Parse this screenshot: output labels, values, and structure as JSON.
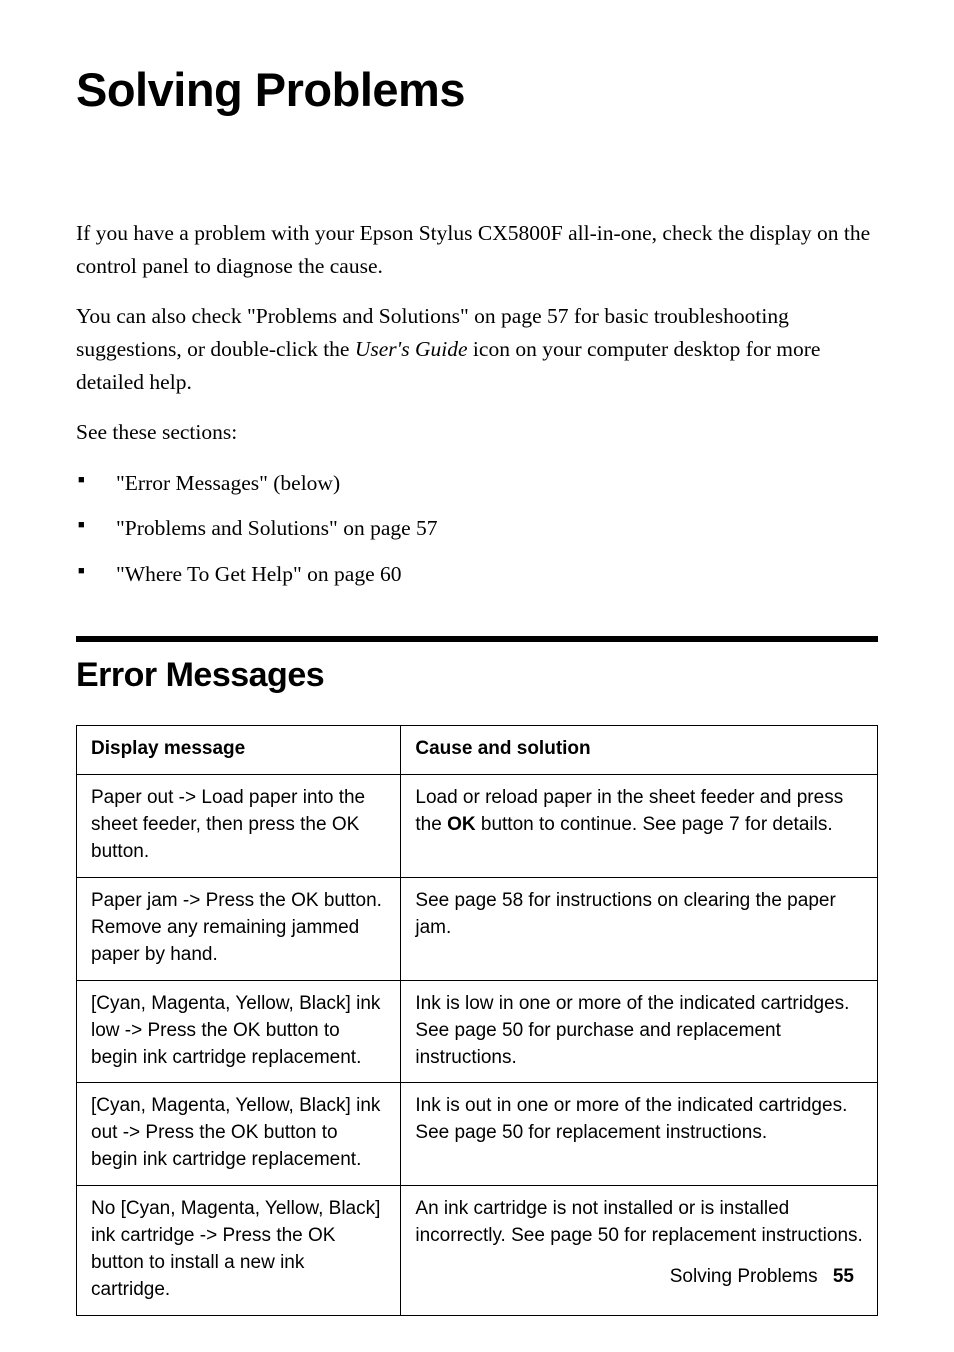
{
  "title": "Solving Problems",
  "intro": {
    "p1": "If you have a problem with your Epson Stylus CX5800F all-in-one, check the display on the control panel to diagnose the cause.",
    "p2a": "You can also check \"Problems and Solutions\" on page 57 for basic troubleshooting suggestions, or double-click the ",
    "p2b": "User's Guide",
    "p2c": " icon on your computer desktop for more detailed help.",
    "see": "See these sections:"
  },
  "bullets": [
    "\"Error Messages\" (below)",
    "\"Problems and Solutions\" on page 57",
    "\"Where To Get Help\" on page 60"
  ],
  "section_heading": "Error Messages",
  "table": {
    "headers": [
      "Display message",
      "Cause and solution"
    ],
    "rows": [
      {
        "msg": "Paper out -> Load paper into the sheet feeder, then press the OK button.",
        "sol_a": "Load or reload paper in the sheet feeder and press the ",
        "sol_b": "OK",
        "sol_c": " button to continue. See page 7 for details."
      },
      {
        "msg": "Paper jam -> Press the OK button. Remove any remaining jammed paper by hand.",
        "sol": "See page 58 for instructions on clearing the paper jam."
      },
      {
        "msg": "[Cyan, Magenta, Yellow, Black] ink low -> Press the OK button to begin ink cartridge replacement.",
        "sol": "Ink is low in one or more of the indicated cartridges. See page 50 for purchase and replacement instructions."
      },
      {
        "msg": "[Cyan, Magenta, Yellow, Black] ink out -> Press the OK button to begin ink cartridge replacement.",
        "sol": "Ink is out in one or more of the indicated cartridges. See page 50 for replacement instructions."
      },
      {
        "msg": "No [Cyan, Magenta, Yellow, Black] ink cartridge -> Press the OK button to install a new ink cartridge.",
        "sol": "An ink cartridge is not installed or is installed incorrectly. See page 50 for replacement instructions."
      }
    ]
  },
  "footer": {
    "label": "Solving Problems",
    "page": "55"
  }
}
